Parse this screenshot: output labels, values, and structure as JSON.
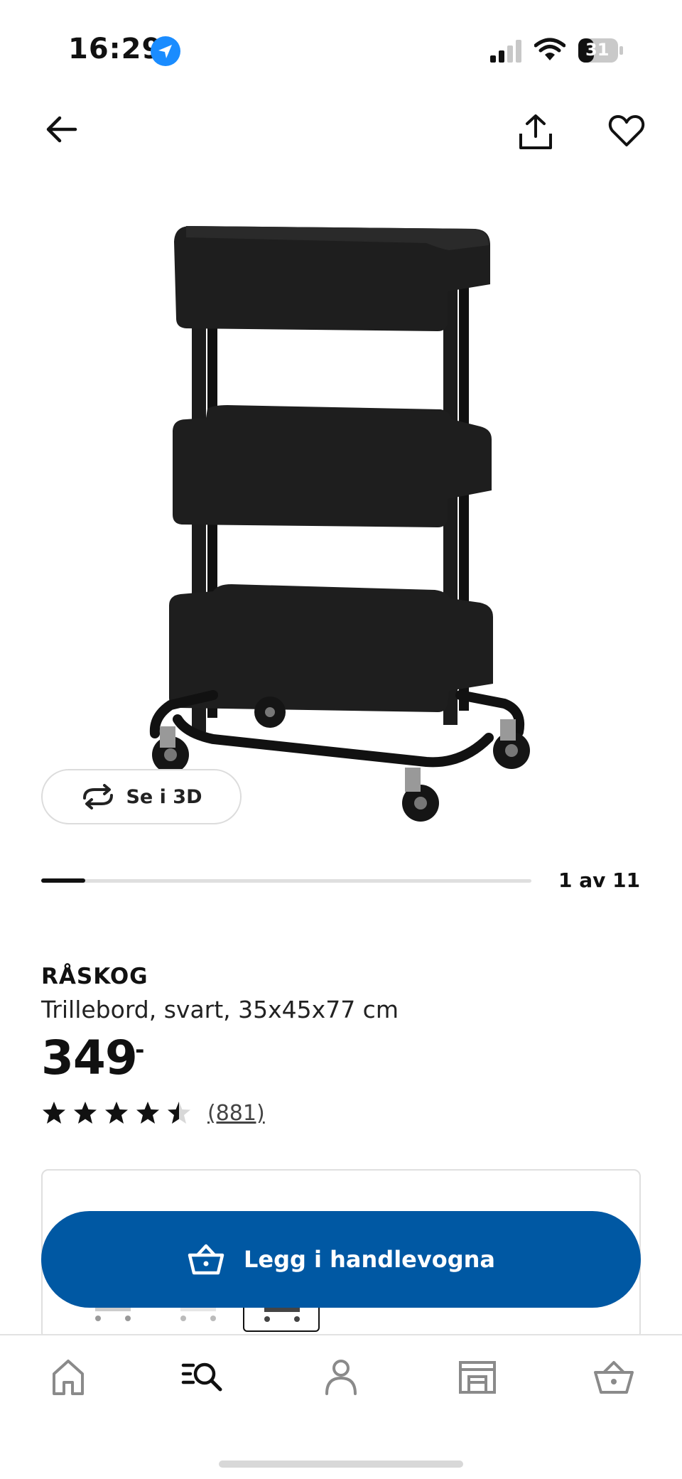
{
  "status_bar": {
    "time": "16:29",
    "battery": "31",
    "icons": [
      "location-arrow-icon",
      "signal-icon",
      "wifi-icon",
      "battery-icon"
    ]
  },
  "top_bar": {
    "icons": [
      "back-arrow-icon",
      "share-icon",
      "heart-icon"
    ]
  },
  "gallery": {
    "view_3d_label": "Se i 3D",
    "page_indicator": "1 av 11",
    "progress_fraction": 0.09
  },
  "product": {
    "name": "RÅSKOG",
    "description": "Trillebord, svart, 35x45x77 cm",
    "price": "349",
    "price_suffix": ",-",
    "rating": 4.5,
    "review_count": "(881)"
  },
  "cart_button": {
    "label": "Legg i handlevogna",
    "icon": "basket-icon"
  },
  "bottom_nav": {
    "items": [
      "home-icon",
      "search-list-icon",
      "profile-icon",
      "store-icon",
      "basket-icon"
    ],
    "active": "search-list-icon"
  },
  "colors": {
    "primary_blue": "#0058a3",
    "location_blue": "#1a8cff",
    "text": "#111111"
  }
}
